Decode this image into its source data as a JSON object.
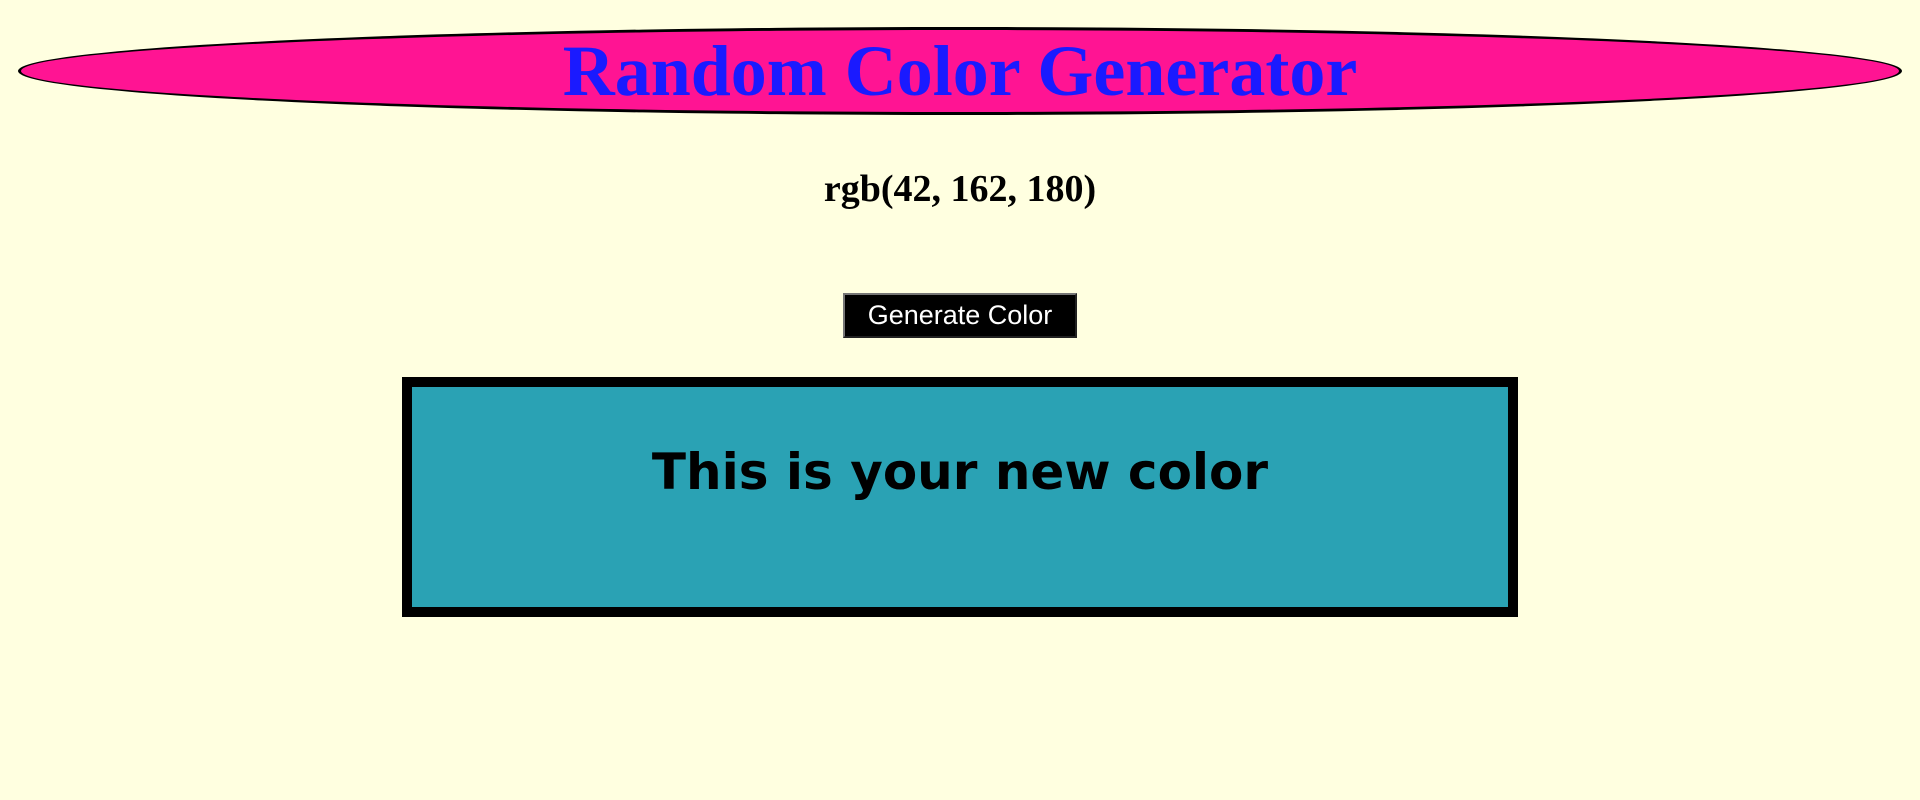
{
  "page": {
    "background_color": "#ffffe0",
    "title": "Random Color Generator",
    "title_color": "#1a1aff",
    "banner_color": "#ff1493"
  },
  "color": {
    "rgb_text": "rgb(42, 162, 180)",
    "swatch_color": "#2aa2b4",
    "message": "This is your new color"
  },
  "controls": {
    "generate_label": "Generate Color"
  }
}
